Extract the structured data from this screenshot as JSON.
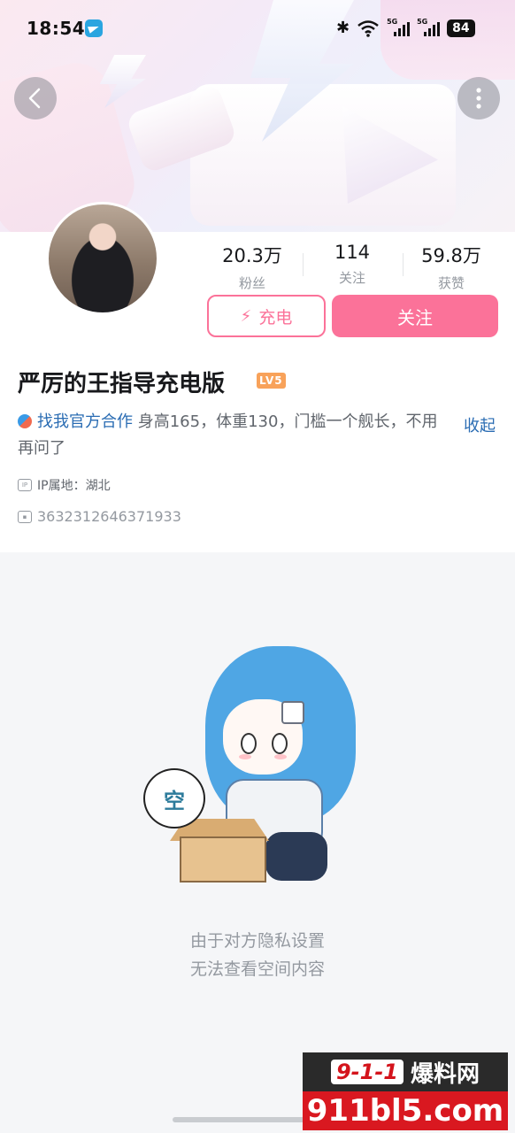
{
  "status_bar": {
    "time": "18:54",
    "battery": "84",
    "network_label": "5G"
  },
  "profile": {
    "name": "严厉的王指导充电版",
    "level": "LV5",
    "stats": [
      {
        "value": "20.3万",
        "label": "粉丝"
      },
      {
        "value": "114",
        "label": "关注"
      },
      {
        "value": "59.8万",
        "label": "获赞"
      }
    ],
    "charge_label": "充电",
    "follow_label": "关注",
    "bio_link": "找我官方合作",
    "bio_text": "身高165，体重130，门槛一个舰长，不用再问了",
    "collapse_label": "收起",
    "ip_icon_text": "IP",
    "ip_label": "IP属地：湖北",
    "uid": "3632312646371933"
  },
  "empty_state": {
    "bubble_text": "空",
    "line1": "由于对方隐私设置",
    "line2": "无法查看空间内容"
  },
  "watermark": {
    "top_left": "9-1-1",
    "top_right": "爆料网",
    "bottom": "911bl5.com"
  },
  "colors": {
    "accent": "#fb7299",
    "link": "#2a6cb3",
    "muted": "#9499a0"
  }
}
